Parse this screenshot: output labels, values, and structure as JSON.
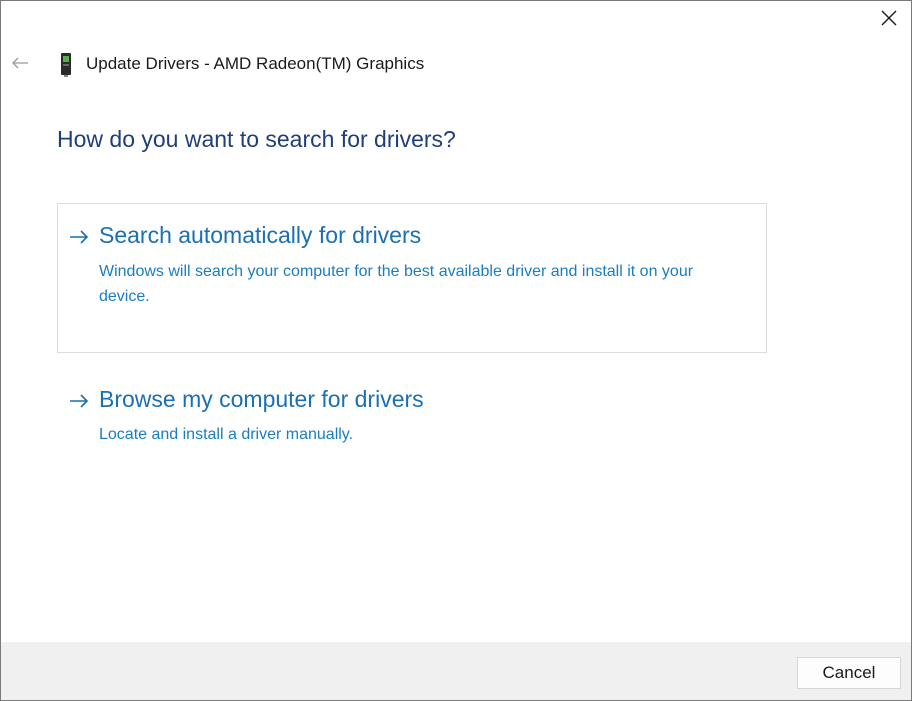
{
  "window": {
    "title": "Update Drivers - AMD Radeon(TM) Graphics",
    "close_icon": "close-icon",
    "back_icon": "back-arrow-icon",
    "device_icon": "graphics-card-icon"
  },
  "main": {
    "heading": "How do you want to search for drivers?",
    "options": [
      {
        "icon": "arrow-right-icon",
        "title": "Search automatically for drivers",
        "description": "Windows will search your computer for the best available driver and install it on your device.",
        "selected": true
      },
      {
        "icon": "arrow-right-icon",
        "title": "Browse my computer for drivers",
        "description": "Locate and install a driver manually.",
        "selected": false
      }
    ]
  },
  "footer": {
    "cancel_label": "Cancel"
  },
  "colors": {
    "heading": "#1f3f7a",
    "link": "#1a6fb5",
    "footer_bg": "#f0f0f0"
  }
}
